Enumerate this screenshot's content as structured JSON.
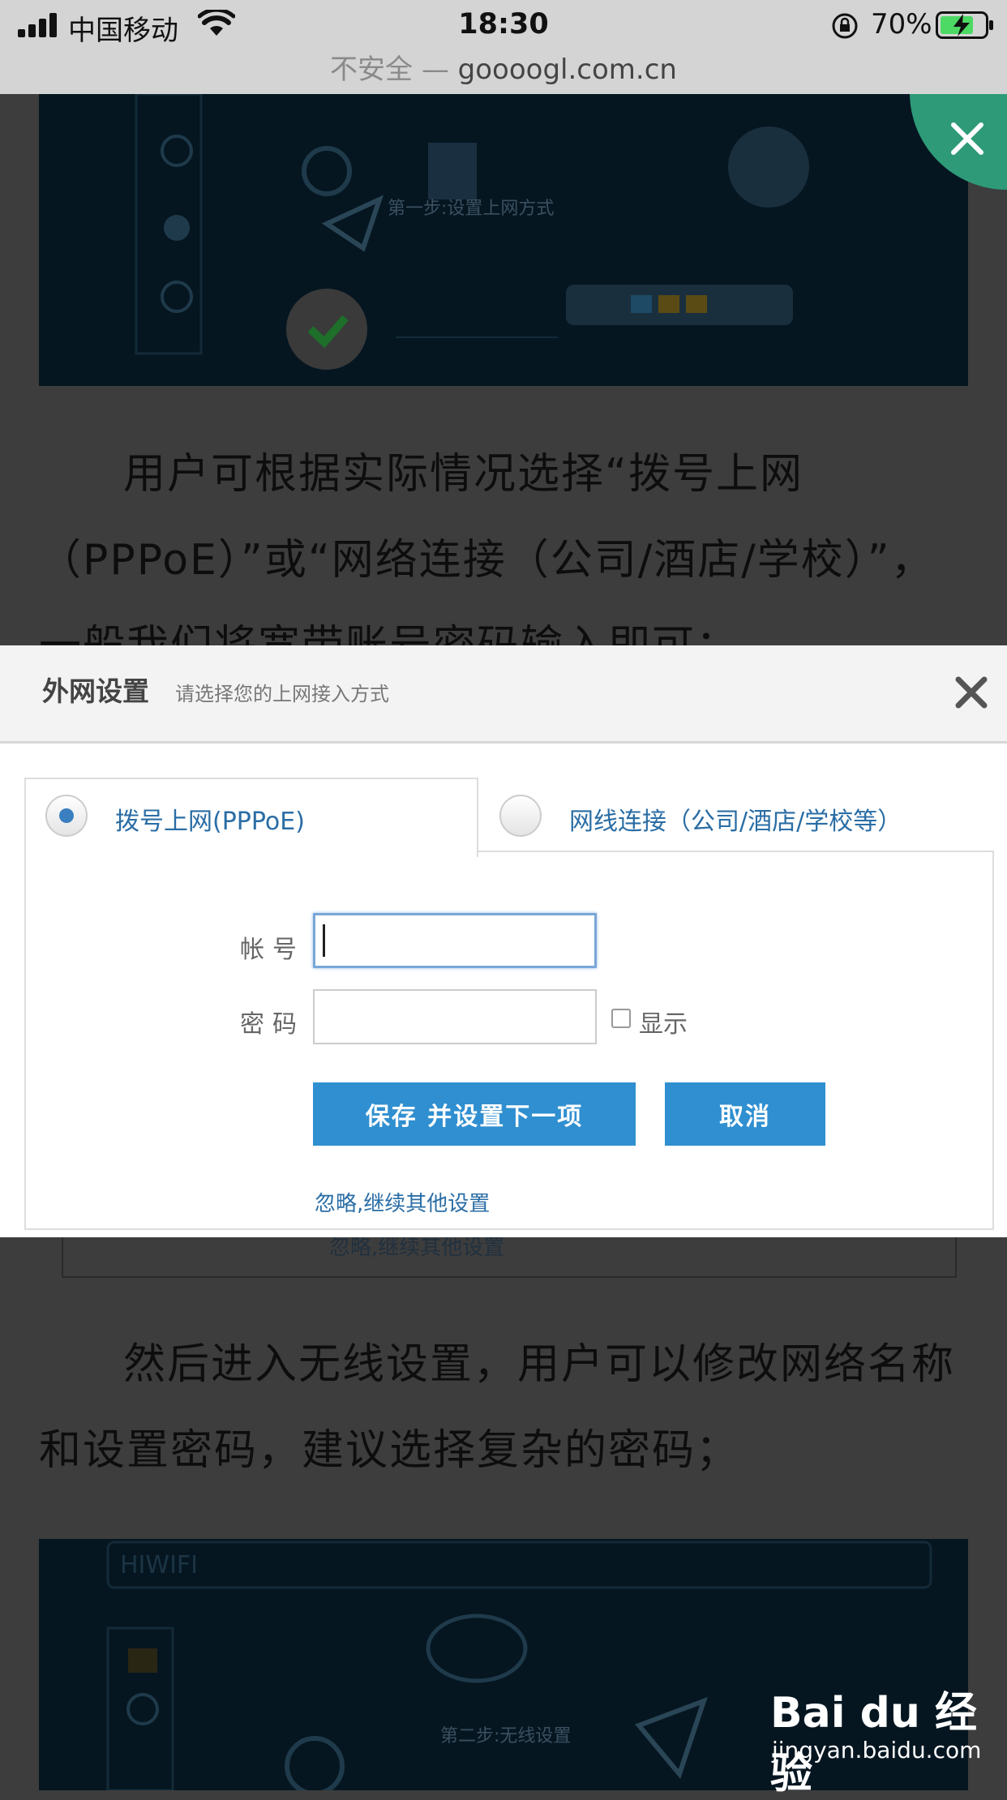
{
  "status_bar": {
    "carrier": "中国移动",
    "time": "18:30",
    "battery_percent": "70%"
  },
  "url_bar": {
    "security_label": "不安全",
    "separator": " — ",
    "domain": "goooogl.com.cn"
  },
  "article": {
    "paragraph_1": "用户可根据实际情况选择“拨号上网（PPPoE）”或“网络连接（公司/酒店/学校）”，一般我们将宽带账号密码输入即可；",
    "paragraph_2": "然后进入无线设置，用户可以修改网络名称和设置密码，建议选择复杂的密码；"
  },
  "dialog": {
    "title": "外网设置",
    "subtitle": "请选择您的上网接入方式",
    "tab_pppoe": "拨号上网(PPPoE)",
    "tab_cable": "网线连接（公司/酒店/学校等）",
    "account_label": "帐号",
    "password_label": "密码",
    "show_label": "显示",
    "save_button": "保存  并设置下一项",
    "cancel_button": "取消",
    "skip_link": "忽略,继续其他设置",
    "ghost_skip": "忽略,继续其他设置",
    "account_value": "",
    "password_value": ""
  },
  "watermark": {
    "logo": "Bai du 经验",
    "url": "jingyan.baidu.com"
  },
  "colors": {
    "accent_button": "#2f8fd0",
    "close_fab": "#2e9a78",
    "link": "#2a6da5"
  }
}
